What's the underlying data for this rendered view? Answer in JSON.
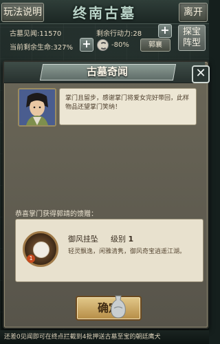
{
  "header": {
    "rules_button": "玩法说明",
    "title": "终南古墓",
    "leave_button": "离开"
  },
  "stats": {
    "insight_label": "古墓见闻:",
    "insight_value": "11570",
    "action_label": "剩余行动力:",
    "action_value": "28",
    "hp_label": "当前剩余生命:",
    "hp_value": "327%",
    "debuff_value": "-80%",
    "guo_button": "郭襄",
    "treasure_button_line1": "探宝",
    "treasure_button_line2": "阵型"
  },
  "dialog": {
    "title": "古墓奇闻",
    "close_glyph": "✕",
    "message": "掌门且留步，感谢掌门将爱女完好带回，此样物品还望掌门笑纳！",
    "reward_label": "恭喜掌门获得郭靖的馈赠：",
    "item": {
      "name": "御风挂坠",
      "level_label": "级别",
      "level": "1",
      "count": "1",
      "description": "轻灵飘逸，闲雅清隽，御风奇宝逍遥江湖。"
    },
    "confirm_button": "确定"
  },
  "footer": {
    "text": "还差0见闻即可在终点拦截到4批押送古墓至宝的朝廷鹰犬"
  },
  "colors": {
    "dialog_bg": "#5f5c50",
    "confirm_gold": "#d2b06a",
    "panel_paper": "#ece6d4"
  }
}
